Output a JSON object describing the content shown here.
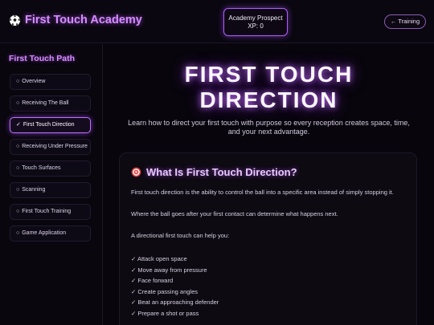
{
  "header": {
    "brand_icon": "soccer-ball-icon",
    "brand_title": "First Touch Academy",
    "rank_label": "Academy Prospect",
    "xp_label": "XP: 0",
    "training_button": "← Training"
  },
  "sidebar": {
    "title": "First Touch Path",
    "items": [
      {
        "mark": "○",
        "label": "Overview",
        "active": false
      },
      {
        "mark": "○",
        "label": "Receiving The Ball",
        "active": false
      },
      {
        "mark": "✓",
        "label": "First Touch Direction",
        "active": true
      },
      {
        "mark": "○",
        "label": "Receiving Under Pressure",
        "active": false
      },
      {
        "mark": "○",
        "label": "Touch Surfaces",
        "active": false
      },
      {
        "mark": "○",
        "label": "Scanning",
        "active": false
      },
      {
        "mark": "○",
        "label": "First Touch Training",
        "active": false
      },
      {
        "mark": "○",
        "label": "Game Application",
        "active": false
      }
    ]
  },
  "main": {
    "hero_title_line1": "FIRST TOUCH",
    "hero_title_line2": "DIRECTION",
    "hero_sub_line1": "Learn how to direct your first touch with purpose so every reception creates space, time,",
    "hero_sub_line2": "and your next advantage.",
    "card": {
      "icon": "target-icon",
      "title": "What Is First Touch Direction?",
      "para1": "First touch direction is the ability to control the ball into a specific area instead of simply stopping it.",
      "para2": "Where the ball goes after your first contact can determine what happens next.",
      "para3": "A directional first touch can help you:",
      "checklist": [
        "✓ Attack open space",
        "✓ Move away from pressure",
        "✓ Face forward",
        "✓ Create passing angles",
        "✓ Beat an approaching defender",
        "✓ Prepare a shot or pass"
      ]
    }
  },
  "colors": {
    "accent": "#d58cff",
    "background": "#08050c",
    "active_border": "#c070ff"
  }
}
